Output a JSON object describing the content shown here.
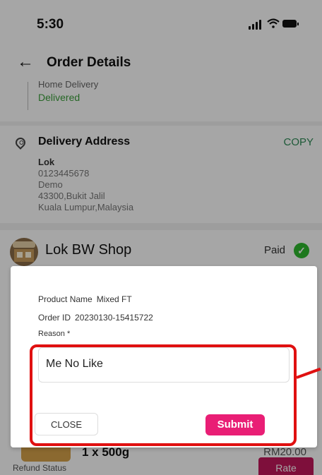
{
  "status_bar": {
    "time": "5:30"
  },
  "header": {
    "title": "Order Details"
  },
  "delivery": {
    "method": "Home Delivery",
    "status": "Delivered"
  },
  "address": {
    "title": "Delivery Address",
    "copy_label": "COPY",
    "name": "Lok",
    "phone": "0123445678",
    "line1": "Demo",
    "line2": "43300,Bukit Jalil",
    "line3": "Kuala Lumpur,Malaysia"
  },
  "shop": {
    "name": "Lok BW Shop",
    "payment_status": "Paid"
  },
  "item": {
    "qty": "1 x 500g",
    "price": "RM20.00"
  },
  "refund": {
    "label": "Refund Status",
    "rate_label": "Rate"
  },
  "modal": {
    "product_label": "Product Name",
    "product_value": "Mixed FT",
    "order_label": "Order ID",
    "order_value": "20230130-15415722",
    "reason_label": "Reason *",
    "reason_value": "Me No Like",
    "close_label": "CLOSE",
    "submit_label": "Submit"
  },
  "colors": {
    "accent": "#e91e75",
    "annotation": "#e01010",
    "delivered": "#3a9f3a"
  }
}
